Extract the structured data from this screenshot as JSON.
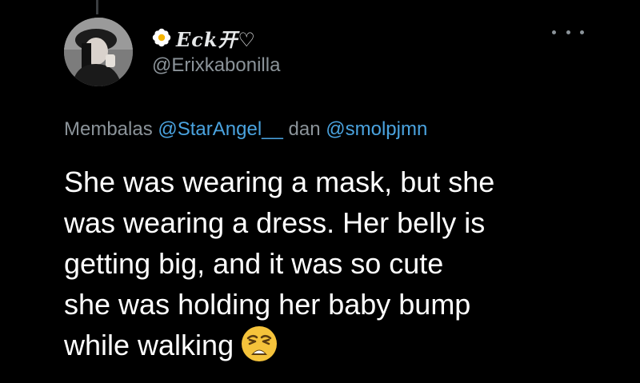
{
  "tweet": {
    "display_name": "Eck开♡",
    "handle": "@Erixkabonilla",
    "reply_to": {
      "prefix": "Membalas",
      "mention1": "@StarAngel__",
      "conjunction": "dan",
      "mention2": "@smolpjmn"
    },
    "text_lines": [
      "She was wearing a mask, but she",
      "was wearing a dress. Her belly is",
      "getting big, and it was so cute",
      "she was holding her baby bump",
      "while walking"
    ],
    "icons": {
      "name_prefix": "flower-icon",
      "menu": "more-icon",
      "emoji": "weary-face-icon"
    },
    "colors": {
      "background": "#000000",
      "text": "#ffffff",
      "secondary": "#8b9399",
      "mention": "#4aa3df",
      "emoji": "#f5c33b"
    }
  }
}
